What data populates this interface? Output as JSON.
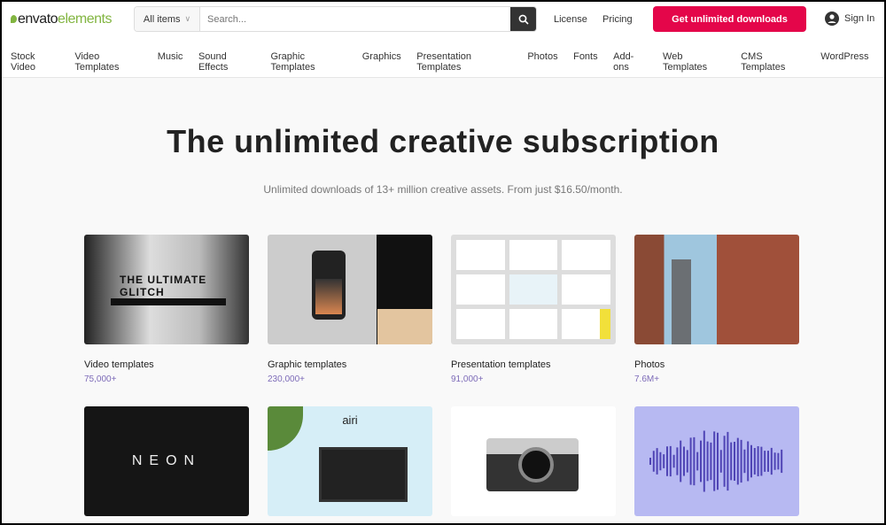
{
  "header": {
    "logo_a": "envato",
    "logo_b": "elements",
    "search_scope": "All items",
    "search_placeholder": "Search...",
    "license": "License",
    "pricing": "Pricing",
    "cta": "Get unlimited downloads",
    "sign_in": "Sign In"
  },
  "nav": [
    "Stock Video",
    "Video Templates",
    "Music",
    "Sound Effects",
    "Graphic Templates",
    "Graphics",
    "Presentation Templates",
    "Photos",
    "Fonts",
    "Add-ons",
    "Web Templates",
    "CMS Templates",
    "WordPress"
  ],
  "hero": {
    "title": "The unlimited creative subscription",
    "subtitle": "Unlimited downloads of 13+ million creative assets. From just $16.50/month."
  },
  "cards": [
    {
      "label": "Video templates",
      "count": "75,000+",
      "thumb_text": "THE ULTIMATE GLITCH"
    },
    {
      "label": "Graphic templates",
      "count": "230,000+"
    },
    {
      "label": "Presentation templates",
      "count": "91,000+"
    },
    {
      "label": "Photos",
      "count": "7.6M+"
    },
    {
      "thumb_text": "NEON"
    },
    {
      "thumb_text": "airi"
    },
    {},
    {}
  ],
  "colors": {
    "accent": "#e4064a",
    "brand_green": "#82b541",
    "count": "#7d6bb8"
  }
}
